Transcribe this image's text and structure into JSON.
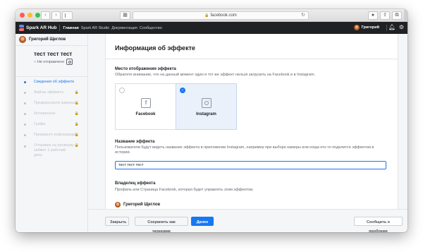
{
  "browser": {
    "url": "facebook.com"
  },
  "topbar": {
    "brand": "Spark AR Hub",
    "nav": [
      "Главная",
      "Spark AR Studio",
      "Документация",
      "Сообщество"
    ],
    "user_name": "Григорий"
  },
  "sidebar": {
    "user_name": "Григорий Щеглов",
    "effect_title": "тест тест тест",
    "effect_status": "Не отправлено",
    "steps": [
      {
        "label": "Сведения об эффекте",
        "active": true,
        "locked": false
      },
      {
        "label": "Файлы эффекта",
        "active": false,
        "locked": true
      },
      {
        "label": "Предпросмотр камеры",
        "active": false,
        "locked": true
      },
      {
        "label": "Интересное",
        "active": false,
        "locked": true
      },
      {
        "label": "Графа",
        "active": false,
        "locked": true
      },
      {
        "label": "Проверьте информацию",
        "active": false,
        "locked": true
      },
      {
        "label": "Отправка на проверку займет 1 рабочий день",
        "active": false,
        "locked": true
      }
    ]
  },
  "main": {
    "title": "Информация об эффекте",
    "placement": {
      "label": "Место отображения эффекта",
      "description": "Обратите внимание, что на данный момент один и тот же эффект нельзя загрузить на Facebook и в Instagram.",
      "options": [
        {
          "label": "Facebook",
          "selected": false
        },
        {
          "label": "Instagram",
          "selected": true
        }
      ]
    },
    "name": {
      "label": "Название эффекта",
      "description": "Пользователи будут видеть название эффекта в приложении Instagram, например при выборе камеры или когда кто-то поделится эффектом в истории.",
      "value": "тест тест тест"
    },
    "owner": {
      "label": "Владелец эффекта",
      "description": "Профиль или Страница Facebook, которая будет управлять этим эффектом.",
      "name": "Григорий Щеглов"
    }
  },
  "footer": {
    "close_label": "Закрыть",
    "draft_label": "Сохранить как черновик",
    "next_label": "Далее",
    "report_label": "Сообщить о проблеме"
  },
  "colors": {
    "accent": "#1877f2",
    "topbar_bg": "#1f2124",
    "page_bg": "#f5f6f7"
  }
}
